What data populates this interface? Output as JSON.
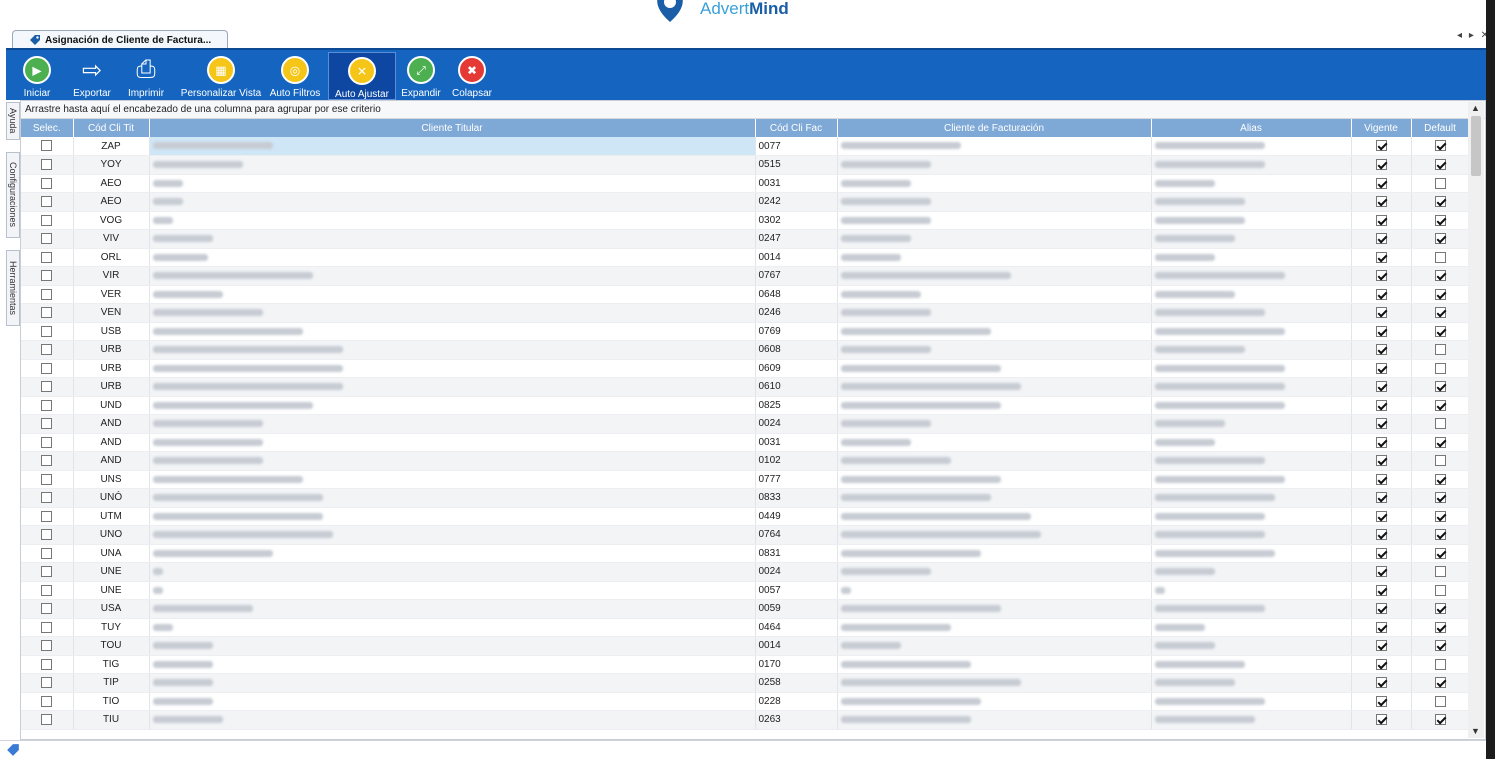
{
  "brand": {
    "light": "Advert",
    "bold": "Mind"
  },
  "tab": {
    "title": "Asignación de Cliente de Factura..."
  },
  "window_controls": "◂ ▸ ✕",
  "toolbar": [
    {
      "name": "iniciar-button",
      "label": "Iniciar",
      "icon": "play-icon",
      "color": "#4caf50"
    },
    {
      "name": "exportar-button",
      "label": "Exportar",
      "icon": "export-icon",
      "color": "#ffffff"
    },
    {
      "name": "imprimir-button",
      "label": "Imprimir",
      "icon": "printer-icon",
      "color": "#ffffff"
    },
    {
      "name": "personalizar-vista-button",
      "label": "Personalizar Vista",
      "icon": "grid-icon",
      "color": "#f5c518"
    },
    {
      "name": "auto-filtros-button",
      "label": "Auto Filtros",
      "icon": "filter-icon",
      "color": "#f5c518"
    },
    {
      "name": "auto-ajustar-button",
      "label": "Auto Ajustar",
      "icon": "wrench-icon",
      "color": "#f5c518"
    },
    {
      "name": "expandir-button",
      "label": "Expandir",
      "icon": "expand-icon",
      "color": "#4caf50"
    },
    {
      "name": "colapsar-button",
      "label": "Colapsar",
      "icon": "collapse-icon",
      "color": "#e53935"
    }
  ],
  "side_tabs": [
    "Ayuda",
    "Configuraciones",
    "Herramientas"
  ],
  "group_hint": "Arrastre hasta aquí el encabezado de una columna para agrupar por ese criterio",
  "columns": [
    "Selec.",
    "Cód Cli Tit",
    "Cliente Titular",
    "Cód Cli Fac",
    "Cliente de Facturación",
    "Alias",
    "Vigente",
    "Default"
  ],
  "rows": [
    {
      "tit": "ZAP",
      "fac": "0077",
      "vig": true,
      "def": true
    },
    {
      "tit": "YOY",
      "fac": "0515",
      "vig": true,
      "def": true
    },
    {
      "tit": "AEO",
      "fac": "0031",
      "vig": true,
      "def": false
    },
    {
      "tit": "AEO",
      "fac": "0242",
      "vig": true,
      "def": true
    },
    {
      "tit": "VOG",
      "fac": "0302",
      "vig": true,
      "def": true
    },
    {
      "tit": "VIV",
      "fac": "0247",
      "vig": true,
      "def": true
    },
    {
      "tit": "ORL",
      "fac": "0014",
      "vig": true,
      "def": false
    },
    {
      "tit": "VIR",
      "fac": "0767",
      "vig": true,
      "def": true
    },
    {
      "tit": "VER",
      "fac": "0648",
      "vig": true,
      "def": true
    },
    {
      "tit": "VEN",
      "fac": "0246",
      "vig": true,
      "def": true
    },
    {
      "tit": "USB",
      "fac": "0769",
      "vig": true,
      "def": true
    },
    {
      "tit": "URB",
      "fac": "0608",
      "vig": true,
      "def": false
    },
    {
      "tit": "URB",
      "fac": "0609",
      "vig": true,
      "def": false
    },
    {
      "tit": "URB",
      "fac": "0610",
      "vig": true,
      "def": true
    },
    {
      "tit": "UND",
      "fac": "0825",
      "vig": true,
      "def": true
    },
    {
      "tit": "AND",
      "fac": "0024",
      "vig": true,
      "def": false
    },
    {
      "tit": "AND",
      "fac": "0031",
      "vig": true,
      "def": true
    },
    {
      "tit": "AND",
      "fac": "0102",
      "vig": true,
      "def": false
    },
    {
      "tit": "UNS",
      "fac": "0777",
      "vig": true,
      "def": true
    },
    {
      "tit": "UNÓ",
      "fac": "0833",
      "vig": true,
      "def": true
    },
    {
      "tit": "UTM",
      "fac": "0449",
      "vig": true,
      "def": true
    },
    {
      "tit": "UNO",
      "fac": "0764",
      "vig": true,
      "def": true
    },
    {
      "tit": "UNA",
      "fac": "0831",
      "vig": true,
      "def": true
    },
    {
      "tit": "UNE",
      "fac": "0024",
      "vig": true,
      "def": false
    },
    {
      "tit": "UNE",
      "fac": "0057",
      "vig": true,
      "def": false
    },
    {
      "tit": "USA",
      "fac": "0059",
      "vig": true,
      "def": true
    },
    {
      "tit": "TUY",
      "fac": "0464",
      "vig": true,
      "def": true
    },
    {
      "tit": "TOU",
      "fac": "0014",
      "vig": true,
      "def": true
    },
    {
      "tit": "TIG",
      "fac": "0170",
      "vig": true,
      "def": false
    },
    {
      "tit": "TIP",
      "fac": "0258",
      "vig": true,
      "def": true
    },
    {
      "tit": "TIO",
      "fac": "0228",
      "vig": true,
      "def": false
    },
    {
      "tit": "TIU",
      "fac": "0263",
      "vig": true,
      "def": true
    }
  ]
}
